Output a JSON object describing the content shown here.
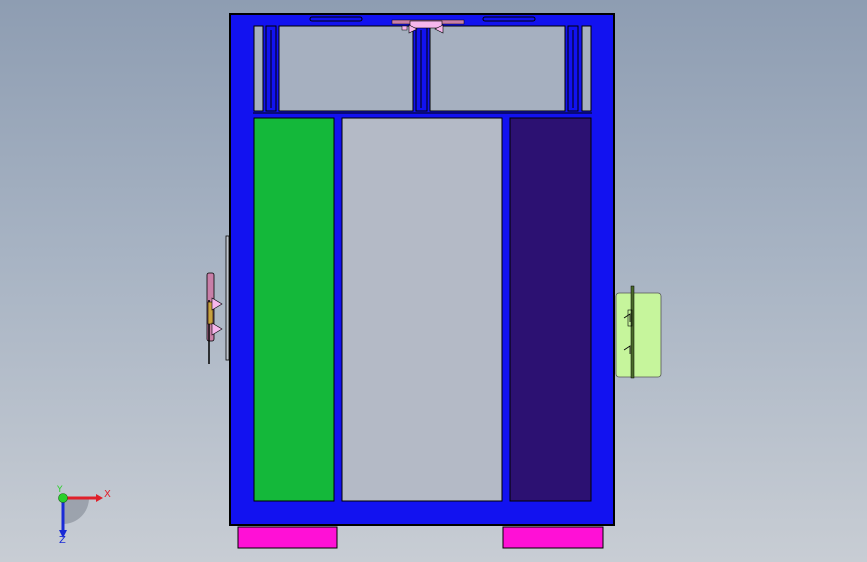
{
  "viewport": {
    "name": "cad-3d-viewport",
    "background_top": "#8e9db2",
    "background_bottom": "#c8cdd4"
  },
  "colors": {
    "frame": "#1212f0",
    "frame_outline": "#000000",
    "panel_green": "#14b83a",
    "panel_gray": "#b4bac6",
    "panel_purple": "#2c1172",
    "feet": "#ff10d6",
    "side_box": "#c6f59c",
    "handle": "#c87fa8",
    "arrow_fill": "#f6b6ec",
    "hinge": "#4a6b2b"
  },
  "triad": {
    "x_label": "X",
    "y_label": "Y",
    "z_label": "Z",
    "x_color": "#e0202a",
    "y_color": "#2ad02a",
    "z_color": "#1a2bd6"
  }
}
